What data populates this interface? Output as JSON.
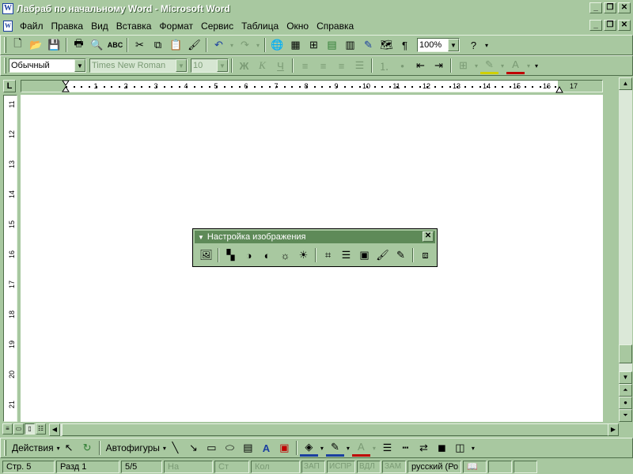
{
  "window": {
    "title": "Лабраб по начальному Word - Microsoft Word",
    "app_icon": "W",
    "doc_icon": "W"
  },
  "menu": {
    "items": [
      "Файл",
      "Правка",
      "Вид",
      "Вставка",
      "Формат",
      "Сервис",
      "Таблица",
      "Окно",
      "Справка"
    ]
  },
  "standard_toolbar": {
    "zoom": "100%"
  },
  "formatting_toolbar": {
    "style": "Обычный",
    "font": "Times New Roman",
    "size": "10",
    "bold": "Ж",
    "italic": "К",
    "underline": "Ч",
    "font_color_glyph": "А"
  },
  "ruler": {
    "tab_selector": "L",
    "h_numbers": [
      "1",
      "2",
      "3",
      "4",
      "5",
      "6",
      "7",
      "8",
      "9",
      "10",
      "11",
      "12",
      "13",
      "14",
      "15",
      "16",
      "17"
    ],
    "v_numbers": [
      "11",
      "12",
      "13",
      "14",
      "15",
      "16",
      "17",
      "18",
      "19",
      "20",
      "21"
    ]
  },
  "picture_toolbar": {
    "title": "Настройка изображения",
    "close": "✕"
  },
  "drawing_toolbar": {
    "actions": "Действия",
    "autoshapes": "Автофигуры",
    "font_color_glyph": "А"
  },
  "status": {
    "page": "Стр. 5",
    "section": "Разд 1",
    "pages": "5/5",
    "at": "На",
    "line": "Ст",
    "col": "Кол",
    "rec": "ЗАП",
    "trk": "ИСПР",
    "ext": "ВДЛ",
    "ovr": "ЗАМ",
    "language": "русский (Ро"
  }
}
